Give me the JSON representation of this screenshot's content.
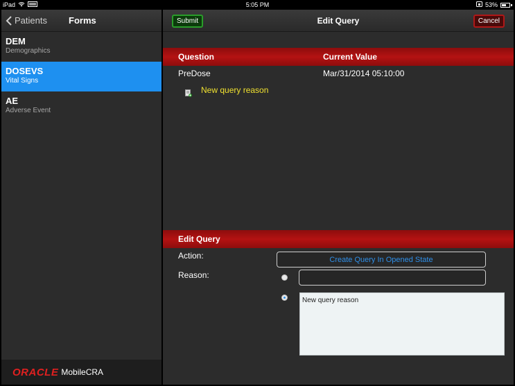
{
  "status_bar": {
    "device": "iPad",
    "time": "5:05 PM",
    "battery": "53%"
  },
  "left_panel": {
    "back_label": "Patients",
    "title": "Forms",
    "items": [
      {
        "code": "DEM",
        "description": "Demographics",
        "selected": false
      },
      {
        "code": "DOSEVS",
        "description": "Vital Signs",
        "selected": true
      },
      {
        "code": "AE",
        "description": "Adverse Event",
        "selected": false
      }
    ],
    "footer": {
      "brand": "ORACLE",
      "product": "MobileCRA"
    }
  },
  "right_panel": {
    "title": "Edit Query",
    "submit_label": "Submit",
    "cancel_label": "Cancel",
    "table_headers": {
      "question": "Question",
      "current_value": "Current Value"
    },
    "row": {
      "question": "PreDose",
      "current_value": "Mar/31/2014 05:10:00"
    },
    "query_reason_link": "New query reason",
    "edit_section": {
      "title": "Edit Query",
      "action_label": "Action:",
      "action_value": "Create Query In Opened State",
      "reason_label": "Reason:",
      "reason_input_value": "",
      "reason_text_value": "New query reason"
    }
  },
  "colors": {
    "accent_blue": "#1e90f0",
    "header_red": "#b41212",
    "link_yellow": "#f0e130",
    "submit_green": "#2a9d2a",
    "cancel_red": "#b01818"
  }
}
